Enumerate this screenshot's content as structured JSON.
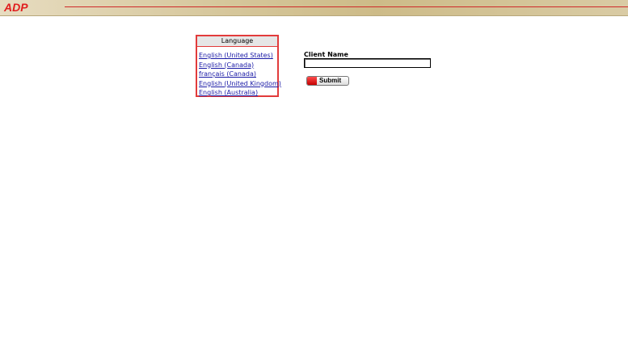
{
  "header": {
    "logo_text": "ADP",
    "brand_color": "#e01e1e"
  },
  "language_panel": {
    "title": "Language",
    "items": [
      {
        "label": "English (United States)"
      },
      {
        "label": "English (Canada)"
      },
      {
        "label": "français (Canada)"
      },
      {
        "label": "English (United Kingdom)"
      },
      {
        "label": "English (Australia)"
      }
    ]
  },
  "login_form": {
    "client_name_label": "Client Name",
    "client_name_value": "",
    "submit_label": "Submit"
  }
}
